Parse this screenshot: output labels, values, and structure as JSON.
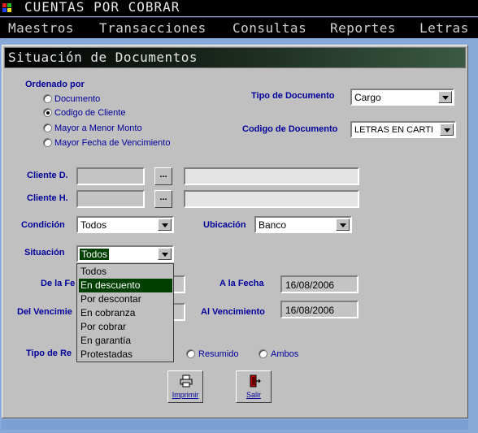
{
  "app": {
    "title": "CUENTAS POR COBRAR"
  },
  "menu": [
    "Maestros",
    "Transacciones",
    "Consultas",
    "Reportes",
    "Letras"
  ],
  "window": {
    "title": "Situación de Documentos"
  },
  "ordenado": {
    "label": "Ordenado por",
    "options": [
      "Documento",
      "Codigo de Cliente",
      "Mayor a Menor Monto",
      "Mayor Fecha de Vencimiento"
    ],
    "selected": 1
  },
  "tipo_documento": {
    "label": "Tipo de Documento",
    "value": "Cargo"
  },
  "codigo_documento": {
    "label": "Codigo de Documento",
    "value": "LETRAS EN CARTI"
  },
  "cliente_d": {
    "label": "Cliente D.",
    "code": "",
    "name": ""
  },
  "cliente_h": {
    "label": "Cliente H.",
    "code": "",
    "name": ""
  },
  "dots_label": "...",
  "condicion": {
    "label": "Condición",
    "value": "Todos"
  },
  "ubicacion": {
    "label": "Ubicación",
    "value": "Banco"
  },
  "situacion": {
    "label": "Situación",
    "value": "Todos",
    "options": [
      "Todos",
      "En descuento",
      "Por descontar",
      "En cobranza",
      "Por cobrar",
      "En garantía",
      "Protestadas"
    ],
    "highlighted": 1
  },
  "de_la_fecha": {
    "label": "De la Fe"
  },
  "a_la_fecha": {
    "label": "A la Fecha",
    "value": "16/08/2006"
  },
  "del_vencimiento": {
    "label": "Del Vencimie"
  },
  "al_vencimiento": {
    "label": "Al Vencimiento",
    "value": "16/08/2006"
  },
  "tipo_reporte": {
    "label": "Tipo de Re",
    "options": [
      "Resumido",
      "Ambos"
    ]
  },
  "buttons": {
    "imprimir": "Imprimir",
    "salir": "Salir"
  },
  "colors": {
    "label": "#00009a",
    "selection": "#004000",
    "background": "#c0c0c0",
    "desktop": "#86a9d8"
  }
}
